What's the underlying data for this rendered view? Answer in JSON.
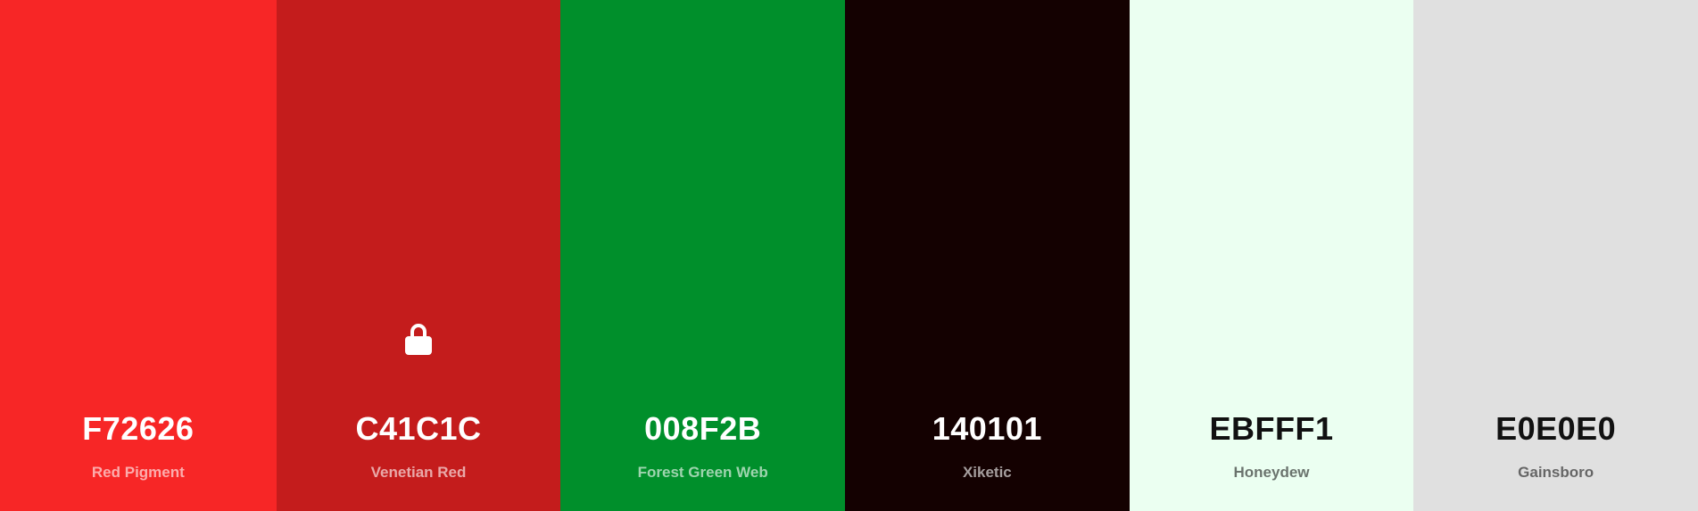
{
  "palette": {
    "swatches": [
      {
        "hex": "F72626",
        "name": "Red Pigment",
        "color": "#F72626",
        "text_tone": "light",
        "locked": false
      },
      {
        "hex": "C41C1C",
        "name": "Venetian Red",
        "color": "#C41C1C",
        "text_tone": "light",
        "locked": true,
        "lock_icon": "lock-icon"
      },
      {
        "hex": "008F2B",
        "name": "Forest Green Web",
        "color": "#008F2B",
        "text_tone": "light",
        "locked": false
      },
      {
        "hex": "140101",
        "name": "Xiketic",
        "color": "#140101",
        "text_tone": "light",
        "locked": false
      },
      {
        "hex": "EBFFF1",
        "name": "Honeydew",
        "color": "#EBFFF1",
        "text_tone": "dark",
        "locked": false
      },
      {
        "hex": "E0E0E0",
        "name": "Gainsboro",
        "color": "#E0E0E0",
        "text_tone": "dark",
        "locked": false
      }
    ]
  }
}
